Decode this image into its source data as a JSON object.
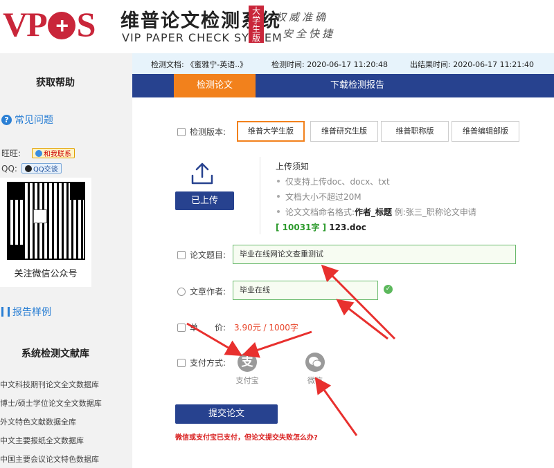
{
  "header": {
    "logo_letters_1": "VP",
    "logo_letters_2": "S",
    "title_cn": "维普论文检测系统",
    "title_en": "VIP PAPER CHECK SYSTEM",
    "badge": "大学生版",
    "slogan_1": "权威准确",
    "slogan_2": "安全快捷"
  },
  "sidebar": {
    "help_title": "获取帮助",
    "faq_label": "常见问题",
    "wangwang_label": "旺旺:",
    "wangwang_button": "和我联系",
    "qq_label": "QQ:",
    "qq_button": "QQ交谈",
    "qr_caption": "关注微信公众号",
    "report_sample_label": "报告样例",
    "library_title": "系统检测文献库",
    "libraries": [
      "中文科技期刊论文全文数据库",
      "博士/硕士学位论文全文数据库",
      "外文特色文献数据全库",
      "中文主要报纸全文数据库",
      "中国主要会议论文特色数据库"
    ]
  },
  "infobar": {
    "doc_label": "检测文档:",
    "doc_value": "《蜜雅宁-英语..》",
    "check_time_label": "检测时间:",
    "check_time_value": "2020-06-17 11:20:48",
    "result_time_label": "出结果时间:",
    "result_time_value": "2020-06-17 11:21:40"
  },
  "tabs": {
    "check": "检测论文",
    "download": "下载检测报告"
  },
  "form": {
    "version_label": "检测版本:",
    "versions": [
      "维普大学生版",
      "维普研究生版",
      "维普职称版",
      "维普编辑部版"
    ],
    "uploaded_button": "已上传",
    "notice_title": "上传须知",
    "notice_1": "仅支持上传doc、docx、txt",
    "notice_2": "文档大小不超过20M",
    "notice_3_prefix": "论文文档命名格式:",
    "notice_3_bold": "作者_标题",
    "notice_3_suffix": "例:张三_职称论文申请",
    "file_count": "[ 10031字 ]",
    "file_name": "123.doc",
    "title_label": "论文题目:",
    "title_value": "毕业在线网论文查重测试",
    "author_label": "文章作者:",
    "author_value": "毕业在线",
    "price_label": "单",
    "price_label_2": "价:",
    "price_value": "3.90元 / 1000字",
    "pay_label": "支付方式:",
    "alipay_label": "支付宝",
    "alipay_glyph": "支",
    "wechat_label": "微信",
    "submit_button": "提交论文",
    "warning": "微信或支付宝已支付，但论文提交失败怎么办?"
  },
  "colors": {
    "navy": "#27428f",
    "orange": "#f2811c",
    "brand_red": "#c9263a",
    "link_blue": "#2a7fd4",
    "annotation_red": "#e8302e"
  }
}
